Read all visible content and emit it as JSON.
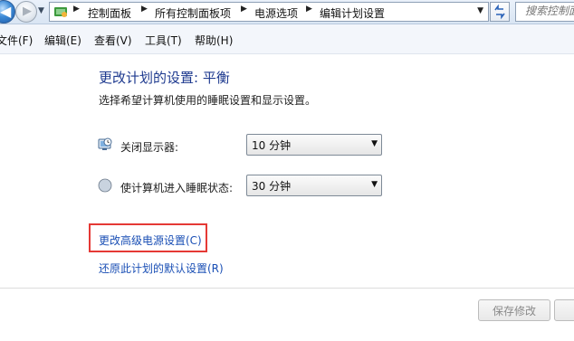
{
  "address_bar": {
    "breadcrumbs": [
      "控制面板",
      "所有控制面板项",
      "电源选项",
      "编辑计划设置"
    ],
    "search_placeholder": "搜索控制面板"
  },
  "menu": [
    "文件(F)",
    "编辑(E)",
    "查看(V)",
    "工具(T)",
    "帮助(H)"
  ],
  "main": {
    "title": "更改计划的设置: 平衡",
    "subtitle": "选择希望计算机使用的睡眠设置和显示设置。",
    "settings": [
      {
        "label": "关闭显示器:",
        "value": "10 分钟",
        "icon": "monitor-clock-icon"
      },
      {
        "label": "使计算机进入睡眠状态:",
        "value": "30 分钟",
        "icon": "moon-sleep-icon"
      }
    ],
    "links": {
      "advanced": "更改高级电源设置(C)",
      "restore": "还原此计划的默认设置(R)"
    }
  },
  "footer": {
    "save_label": "保存修改"
  },
  "colors": {
    "title": "#1e3a8f",
    "link": "#1a4fb5",
    "highlight_border": "#e53935"
  }
}
